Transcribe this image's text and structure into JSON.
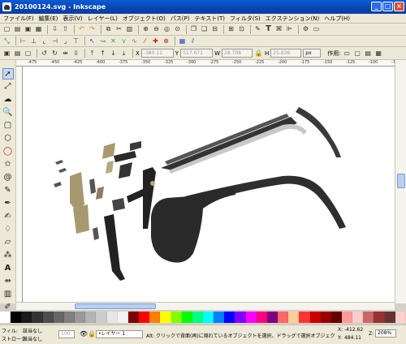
{
  "window": {
    "title": "20100124.svg - Inkscape",
    "controls": [
      "_",
      "□",
      "×"
    ]
  },
  "menu": [
    "ファイル(F)",
    "編集(E)",
    "表示(V)",
    "レイヤー(L)",
    "オブジェクト(O)",
    "パス(P)",
    "テキスト(T)",
    "フィルタ(S)",
    "エクステンション(N)",
    "ヘルプ(H)"
  ],
  "toolbar3": {
    "x_label": "X",
    "x_value": "-380.11",
    "y_label": "Y",
    "y_value": "517.671",
    "w_label": "W",
    "w_value": "28.708",
    "h_label": "H",
    "h_value": "25.836",
    "unit": "px",
    "affect_label": "作用:"
  },
  "ruler": {
    "ticks": [
      "-475",
      "-450",
      "-425",
      "-400",
      "-375",
      "-350",
      "-325",
      "-300",
      "-275",
      "-250",
      "-225",
      "-200",
      "-175",
      "-150",
      "-125",
      "-100",
      "-75"
    ]
  },
  "palette": {
    "colors": [
      "#ffffff",
      "#000000",
      "#1a1a1a",
      "#333333",
      "#4d4d4d",
      "#666666",
      "#808080",
      "#999999",
      "#b3b3b3",
      "#cccccc",
      "#e6e6e6",
      "#f2f2f2",
      "#800000",
      "#ff0000",
      "#ff8000",
      "#ffff00",
      "#80ff00",
      "#00ff00",
      "#00ff80",
      "#00ffff",
      "#0080ff",
      "#0000ff",
      "#8000ff",
      "#ff00ff",
      "#ff0080",
      "#800080",
      "#ff6666",
      "#ffcc99",
      "#ff3333",
      "#cc0000",
      "#990000",
      "#660000",
      "#ff9999",
      "#ffcccc",
      "#cc6666",
      "#993333",
      "#663333",
      "#ffd0d0"
    ]
  },
  "status": {
    "fill_label": "フィル:",
    "stroke_label": "ストローク:",
    "fill_value": "該当なし",
    "stroke_value": "該当なし",
    "opacity_value": "100",
    "layer": "•レイヤー 1",
    "message": "Alt: クリックで背面(再)に隠れているオブジェクトを選択、ドラッグで選択オブジェクトを移動または触",
    "x_label": "X:",
    "x_value": "-412.62",
    "y_label": "Y:",
    "y_value": "484.11",
    "zoom_label": "Z:",
    "zoom_value": "208%"
  }
}
